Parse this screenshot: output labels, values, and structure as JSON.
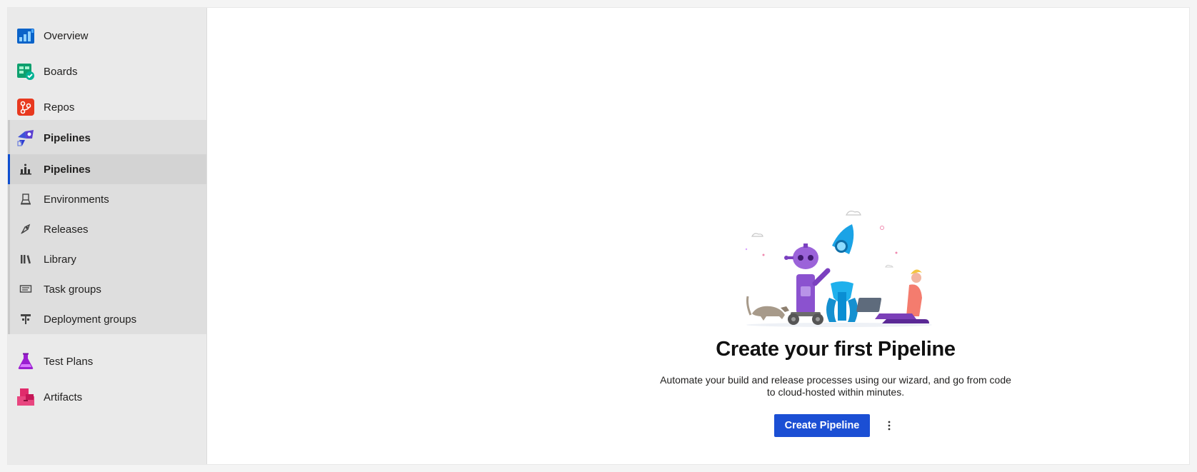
{
  "sidebar": {
    "items": [
      {
        "label": "Overview",
        "icon": "overview-icon",
        "color": "#0078d4"
      },
      {
        "label": "Boards",
        "icon": "boards-icon",
        "color": "#009ccc"
      },
      {
        "label": "Repos",
        "icon": "repos-icon",
        "color": "#e0331f"
      }
    ],
    "pipelines_group": {
      "label": "Pipelines",
      "icon": "pipelines-icon",
      "color": "#5c2d91",
      "sub_items": [
        {
          "label": "Pipelines",
          "icon": "pipelines-sub-icon",
          "selected": true
        },
        {
          "label": "Environments",
          "icon": "environments-icon"
        },
        {
          "label": "Releases",
          "icon": "releases-icon"
        },
        {
          "label": "Library",
          "icon": "library-icon"
        },
        {
          "label": "Task groups",
          "icon": "task-groups-icon"
        },
        {
          "label": "Deployment groups",
          "icon": "deployment-groups-icon"
        }
      ]
    },
    "bottom_items": [
      {
        "label": "Test Plans",
        "icon": "test-plans-icon",
        "color": "#8e1fc7"
      },
      {
        "label": "Artifacts",
        "icon": "artifacts-icon",
        "color": "#d81b60"
      }
    ]
  },
  "main": {
    "empty_state": {
      "illustration": "pipeline-robot-rocket-illustration",
      "title": "Create your first Pipeline",
      "description": "Automate your build and release processes using our wizard, and go from code to cloud-hosted within minutes.",
      "primary_button": "Create Pipeline",
      "more_icon": "more-vertical-icon"
    }
  },
  "colors": {
    "accent": "#1b4fd4",
    "sidebar_bg": "#eaeaea",
    "group_bg": "#dedede",
    "selected_bg": "#d3d3d3"
  }
}
